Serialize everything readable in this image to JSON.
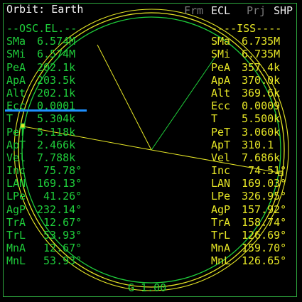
{
  "header": {
    "title": "Orbit: Earth",
    "frm_label": "Frm",
    "frm_value": "ECL",
    "prj_label": "Prj",
    "prj_value": "SHP"
  },
  "left_panel": {
    "heading": "--OSC.EL.--",
    "rows": [
      {
        "label": "SMa",
        "value": "6.574M"
      },
      {
        "label": "SMi",
        "value": "6.574M"
      },
      {
        "label": "PeA",
        "value": "202.1k"
      },
      {
        "label": "ApA",
        "value": "203.5k"
      },
      {
        "label": "Alt",
        "value": "202.1k"
      },
      {
        "label": "Ecc",
        "value": "0.0001"
      },
      {
        "label": "T",
        "value": "5.304k"
      },
      {
        "label": "PeT",
        "value": "5.118k"
      },
      {
        "label": "ApT",
        "value": "2.466k"
      },
      {
        "label": "Vel",
        "value": "7.788k"
      },
      {
        "label": "Inc",
        "value": " 75.78°"
      },
      {
        "label": "LAN",
        "value": "169.13°"
      },
      {
        "label": "LPe",
        "value": " 41.26°"
      },
      {
        "label": "AgP",
        "value": "232.14°"
      },
      {
        "label": "TrA",
        "value": " 12.67°"
      },
      {
        "label": "TrL",
        "value": " 53.93°"
      },
      {
        "label": "MnA",
        "value": " 12.67°"
      },
      {
        "label": "MnL",
        "value": " 53.93°"
      }
    ]
  },
  "right_panel": {
    "heading": "----ISS----",
    "rows": [
      {
        "label": "SMa",
        "value": "6.735M"
      },
      {
        "label": "SMi",
        "value": "6.735M"
      },
      {
        "label": "PeA",
        "value": "357.4k"
      },
      {
        "label": "ApA",
        "value": "370.0k"
      },
      {
        "label": "Alt",
        "value": "369.6k"
      },
      {
        "label": "Ecc",
        "value": "0.0009"
      },
      {
        "label": "T",
        "value": "5.500k"
      },
      {
        "label": "PeT",
        "value": "3.060k"
      },
      {
        "label": "ApT",
        "value": "310.1"
      },
      {
        "label": "Vel",
        "value": "7.686k"
      },
      {
        "label": "Inc",
        "value": " 74.51°"
      },
      {
        "label": "LAN",
        "value": "169.03°"
      },
      {
        "label": "LPe",
        "value": "326.95°"
      },
      {
        "label": "AgP",
        "value": "157.92°"
      },
      {
        "label": "TrA",
        "value": "158.74°"
      },
      {
        "label": "TrL",
        "value": "126.69°"
      },
      {
        "label": "MnA",
        "value": "159.70°"
      },
      {
        "label": "MnL",
        "value": "126.65°"
      }
    ]
  },
  "footer": {
    "scale": "G 1.00"
  },
  "colors": {
    "own_orbit": "#1fce3b",
    "target_orbit": "#e6e626",
    "frame": "#2ea83e",
    "selection": "#1e90ff"
  }
}
